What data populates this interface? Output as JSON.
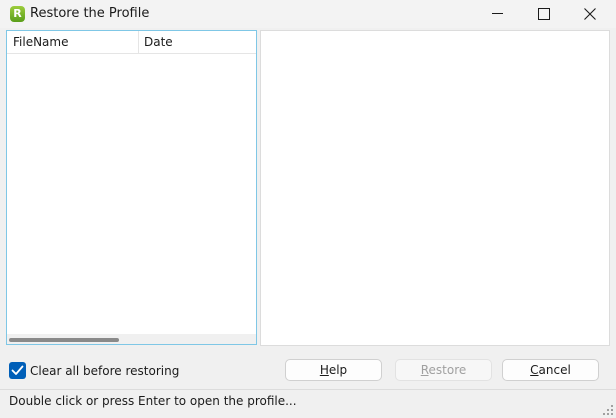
{
  "window": {
    "title": "Restore the Profile",
    "app_icon_letter": "R",
    "accent_color": "#005fb8",
    "icon_color": "#6aad22"
  },
  "title_buttons": {
    "minimize_icon": "minimize-icon",
    "maximize_icon": "maximize-icon",
    "close_icon": "close-icon"
  },
  "file_list": {
    "columns": [
      "FileName",
      "Date"
    ],
    "rows": []
  },
  "options": {
    "clear_all_label": "Clear all before restoring",
    "clear_all_checked": true
  },
  "buttons": {
    "help": {
      "label": "Help",
      "mnemonic_index": 0
    },
    "restore": {
      "label": "Restore",
      "mnemonic_index": 0,
      "enabled": false
    },
    "cancel": {
      "label": "Cancel",
      "mnemonic_index": 0
    }
  },
  "status": {
    "text": "Double click or press Enter to open the profile..."
  }
}
